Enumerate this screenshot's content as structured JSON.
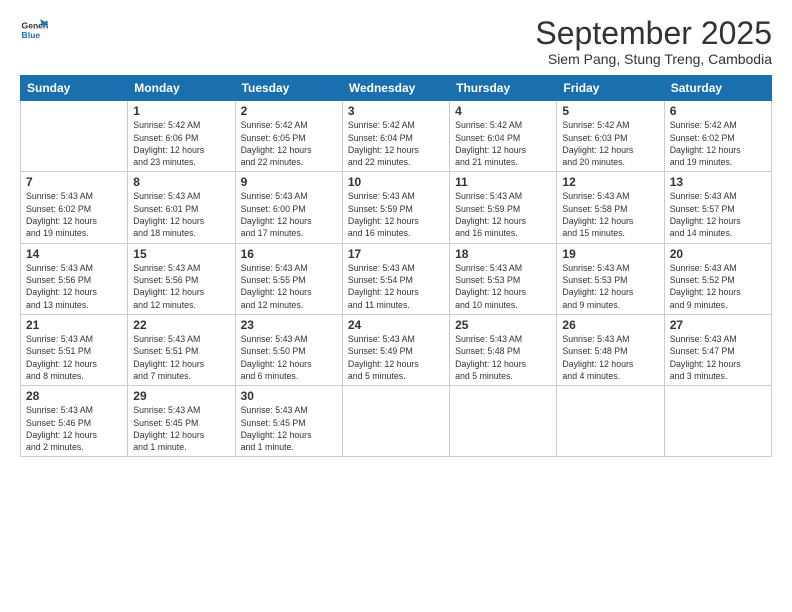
{
  "logo": {
    "line1": "General",
    "line2": "Blue"
  },
  "title": "September 2025",
  "subtitle": "Siem Pang, Stung Treng, Cambodia",
  "days_of_week": [
    "Sunday",
    "Monday",
    "Tuesday",
    "Wednesday",
    "Thursday",
    "Friday",
    "Saturday"
  ],
  "weeks": [
    [
      {
        "num": "",
        "info": ""
      },
      {
        "num": "1",
        "info": "Sunrise: 5:42 AM\nSunset: 6:06 PM\nDaylight: 12 hours\nand 23 minutes."
      },
      {
        "num": "2",
        "info": "Sunrise: 5:42 AM\nSunset: 6:05 PM\nDaylight: 12 hours\nand 22 minutes."
      },
      {
        "num": "3",
        "info": "Sunrise: 5:42 AM\nSunset: 6:04 PM\nDaylight: 12 hours\nand 22 minutes."
      },
      {
        "num": "4",
        "info": "Sunrise: 5:42 AM\nSunset: 6:04 PM\nDaylight: 12 hours\nand 21 minutes."
      },
      {
        "num": "5",
        "info": "Sunrise: 5:42 AM\nSunset: 6:03 PM\nDaylight: 12 hours\nand 20 minutes."
      },
      {
        "num": "6",
        "info": "Sunrise: 5:42 AM\nSunset: 6:02 PM\nDaylight: 12 hours\nand 19 minutes."
      }
    ],
    [
      {
        "num": "7",
        "info": "Sunrise: 5:43 AM\nSunset: 6:02 PM\nDaylight: 12 hours\nand 19 minutes."
      },
      {
        "num": "8",
        "info": "Sunrise: 5:43 AM\nSunset: 6:01 PM\nDaylight: 12 hours\nand 18 minutes."
      },
      {
        "num": "9",
        "info": "Sunrise: 5:43 AM\nSunset: 6:00 PM\nDaylight: 12 hours\nand 17 minutes."
      },
      {
        "num": "10",
        "info": "Sunrise: 5:43 AM\nSunset: 5:59 PM\nDaylight: 12 hours\nand 16 minutes."
      },
      {
        "num": "11",
        "info": "Sunrise: 5:43 AM\nSunset: 5:59 PM\nDaylight: 12 hours\nand 16 minutes."
      },
      {
        "num": "12",
        "info": "Sunrise: 5:43 AM\nSunset: 5:58 PM\nDaylight: 12 hours\nand 15 minutes."
      },
      {
        "num": "13",
        "info": "Sunrise: 5:43 AM\nSunset: 5:57 PM\nDaylight: 12 hours\nand 14 minutes."
      }
    ],
    [
      {
        "num": "14",
        "info": "Sunrise: 5:43 AM\nSunset: 5:56 PM\nDaylight: 12 hours\nand 13 minutes."
      },
      {
        "num": "15",
        "info": "Sunrise: 5:43 AM\nSunset: 5:56 PM\nDaylight: 12 hours\nand 12 minutes."
      },
      {
        "num": "16",
        "info": "Sunrise: 5:43 AM\nSunset: 5:55 PM\nDaylight: 12 hours\nand 12 minutes."
      },
      {
        "num": "17",
        "info": "Sunrise: 5:43 AM\nSunset: 5:54 PM\nDaylight: 12 hours\nand 11 minutes."
      },
      {
        "num": "18",
        "info": "Sunrise: 5:43 AM\nSunset: 5:53 PM\nDaylight: 12 hours\nand 10 minutes."
      },
      {
        "num": "19",
        "info": "Sunrise: 5:43 AM\nSunset: 5:53 PM\nDaylight: 12 hours\nand 9 minutes."
      },
      {
        "num": "20",
        "info": "Sunrise: 5:43 AM\nSunset: 5:52 PM\nDaylight: 12 hours\nand 9 minutes."
      }
    ],
    [
      {
        "num": "21",
        "info": "Sunrise: 5:43 AM\nSunset: 5:51 PM\nDaylight: 12 hours\nand 8 minutes."
      },
      {
        "num": "22",
        "info": "Sunrise: 5:43 AM\nSunset: 5:51 PM\nDaylight: 12 hours\nand 7 minutes."
      },
      {
        "num": "23",
        "info": "Sunrise: 5:43 AM\nSunset: 5:50 PM\nDaylight: 12 hours\nand 6 minutes."
      },
      {
        "num": "24",
        "info": "Sunrise: 5:43 AM\nSunset: 5:49 PM\nDaylight: 12 hours\nand 5 minutes."
      },
      {
        "num": "25",
        "info": "Sunrise: 5:43 AM\nSunset: 5:48 PM\nDaylight: 12 hours\nand 5 minutes."
      },
      {
        "num": "26",
        "info": "Sunrise: 5:43 AM\nSunset: 5:48 PM\nDaylight: 12 hours\nand 4 minutes."
      },
      {
        "num": "27",
        "info": "Sunrise: 5:43 AM\nSunset: 5:47 PM\nDaylight: 12 hours\nand 3 minutes."
      }
    ],
    [
      {
        "num": "28",
        "info": "Sunrise: 5:43 AM\nSunset: 5:46 PM\nDaylight: 12 hours\nand 2 minutes."
      },
      {
        "num": "29",
        "info": "Sunrise: 5:43 AM\nSunset: 5:45 PM\nDaylight: 12 hours\nand 1 minute."
      },
      {
        "num": "30",
        "info": "Sunrise: 5:43 AM\nSunset: 5:45 PM\nDaylight: 12 hours\nand 1 minute."
      },
      {
        "num": "",
        "info": ""
      },
      {
        "num": "",
        "info": ""
      },
      {
        "num": "",
        "info": ""
      },
      {
        "num": "",
        "info": ""
      }
    ]
  ]
}
